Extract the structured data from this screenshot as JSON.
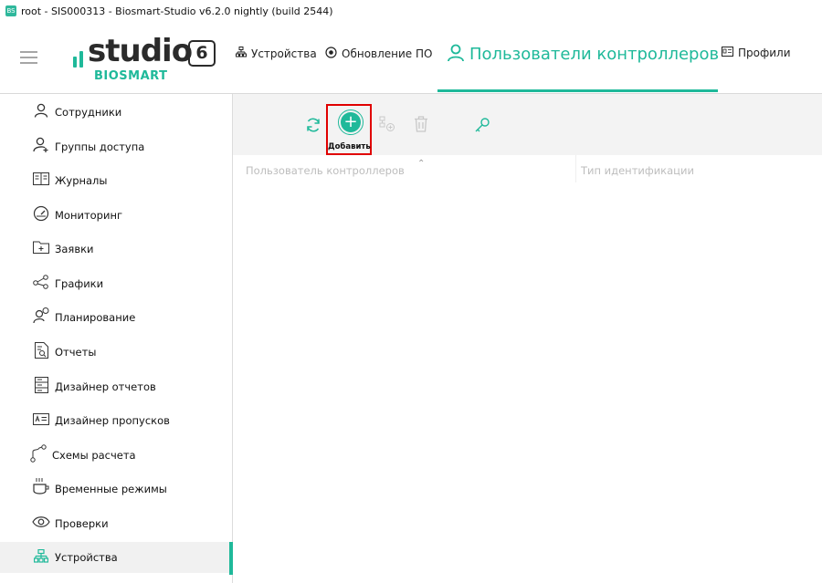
{
  "window": {
    "title": "root - SIS000313 - Biosmart-Studio v6.2.0 nightly (build 2544)"
  },
  "logo": {
    "word": "studio",
    "version": "6",
    "brand": "BIOSMART"
  },
  "nav": {
    "tabs": [
      {
        "label": "Устройства",
        "icon": "devices-icon"
      },
      {
        "label": "Обновление ПО",
        "icon": "update-icon"
      },
      {
        "label": "Пользователи контроллеров",
        "icon": "user-icon",
        "active": true
      },
      {
        "label": "Профили",
        "icon": "profile-card-icon"
      }
    ]
  },
  "sidebar": {
    "items": [
      {
        "label": "Сотрудники",
        "icon": "person-icon"
      },
      {
        "label": "Группы доступа",
        "icon": "group-add-icon"
      },
      {
        "label": "Журналы",
        "icon": "book-icon"
      },
      {
        "label": "Мониторинг",
        "icon": "gauge-icon"
      },
      {
        "label": "Заявки",
        "icon": "folder-plus-icon"
      },
      {
        "label": "Графики",
        "icon": "share-graph-icon"
      },
      {
        "label": "Планирование",
        "icon": "person-clock-icon"
      },
      {
        "label": "Отчеты",
        "icon": "report-search-icon"
      },
      {
        "label": "Дизайнер отчетов",
        "icon": "report-design-icon"
      },
      {
        "label": "Дизайнер пропусков",
        "icon": "badge-design-icon"
      },
      {
        "label": "Схемы расчета",
        "icon": "path-scheme-icon"
      },
      {
        "label": "Временные режимы",
        "icon": "cup-icon"
      },
      {
        "label": "Проверки",
        "icon": "eye-icon"
      },
      {
        "label": "Устройства",
        "icon": "devices-icon",
        "active": true
      }
    ]
  },
  "toolbar": {
    "add_label": "Добавить",
    "icons": [
      "refresh-icon",
      "add-circle-icon",
      "bulk-add-icon",
      "trash-icon",
      "key-icon"
    ]
  },
  "table": {
    "columns": [
      "Пользователь контроллеров",
      "Тип идентификации"
    ]
  },
  "colors": {
    "accent": "#1fb99a",
    "highlight": "#e00000"
  }
}
